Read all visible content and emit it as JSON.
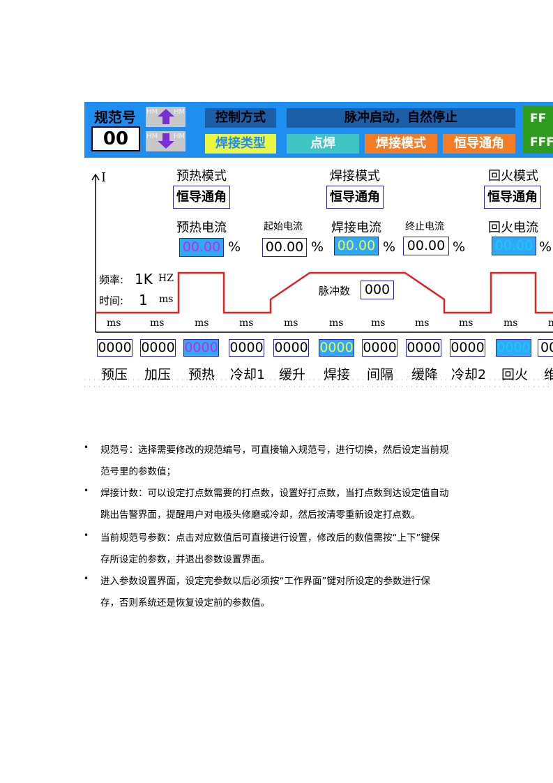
{
  "header": {
    "spec_label": "规范号",
    "spec_value": "00",
    "up_button_overlay": "HM",
    "down_button_overlay": "HM",
    "control_mode_label": "控制方式",
    "control_mode_value": "脉冲启动，自然停止",
    "weld_type_label": "焊接类型",
    "weld_type_value": "点焊",
    "weld_mode_label": "焊接模式",
    "weld_mode_value": "恒导通角",
    "side_top": "FF",
    "side_bottom": "FFF",
    "colors": {
      "topbar": "#1f8ef1",
      "dark_tag": "#1a5fa8",
      "green_tag": "#ecf542",
      "teal_tag": "#3fc6c4",
      "orange_tag": "#f57c22",
      "side_green": "#2e9c1e"
    }
  },
  "graph": {
    "y_axis_label": "I",
    "preheat_mode_label": "预热模式",
    "preheat_mode_value": "恒导通角",
    "weld_mode_label": "焊接模式",
    "weld_mode_value": "恒导通角",
    "temper_mode_label": "回火模式",
    "temper_mode_value": "恒导通角",
    "preheat_current_label": "预热电流",
    "start_current_label": "起始电流",
    "weld_current_label": "焊接电流",
    "end_current_label": "终止电流",
    "temper_current_label": "回火电流",
    "preheat_current_value": "00.00",
    "start_current_value": "00.00",
    "weld_current_value": "00.00",
    "end_current_value": "00.00",
    "temper_current_value": "00.00",
    "percent": "%",
    "freq_label": "频率:",
    "freq_value": "1K",
    "freq_unit": "HZ",
    "time_label": "时间:",
    "time_value": "1",
    "time_unit": "ms",
    "pulse_label": "脉冲数",
    "pulse_value": "000",
    "colors": {
      "waveform": "#e52020",
      "preheat_text": "#d026d8",
      "weld_text": "#1a1a1a",
      "weld_fill": "#2fa8f7",
      "temper_text": "#1ec8f5",
      "temper_fill": "#2fa8f7"
    }
  },
  "timeline": {
    "unit": "ms",
    "phases": [
      {
        "value": "0000",
        "label": "预压"
      },
      {
        "value": "0000",
        "label": "加压"
      },
      {
        "value": "0000",
        "label": "预热"
      },
      {
        "value": "0000",
        "label": "冷却1"
      },
      {
        "value": "0000",
        "label": "缓升"
      },
      {
        "value": "0000",
        "label": "焊接"
      },
      {
        "value": "0000",
        "label": "间隔"
      },
      {
        "value": "0000",
        "label": "缓降"
      },
      {
        "value": "0000",
        "label": "冷却2"
      },
      {
        "value": "0000",
        "label": "回火"
      },
      {
        "value": "00",
        "label": "维"
      }
    ]
  },
  "notes": [
    {
      "line1": "规范号：选择需要修改的规范编号，可直接输入规范号，进行切换，然后设定当前规",
      "line2": "范号里的参数值；"
    },
    {
      "line1": "焊接计数：可以设定打点数需要的打点数，设置好打点数，当打点数到达设定值自动",
      "line2": "跳出告警界面，提醒用户对电极头修磨或冷却，然后按清零重新设定打点数。"
    },
    {
      "line1": "当前规范号参数：点击对应数值后可直接进行设置，修改后的数值需按“上下”键保",
      "line2": "存所设定的参数，并退出参数设置界面。"
    },
    {
      "line1": "进入参数设置界面，设定完参数以后必须按“工作界面”键对所设定的参数进行保",
      "line2": "存，否则系统还是恢复设定前的参数值。"
    }
  ],
  "bullet_char": "•"
}
